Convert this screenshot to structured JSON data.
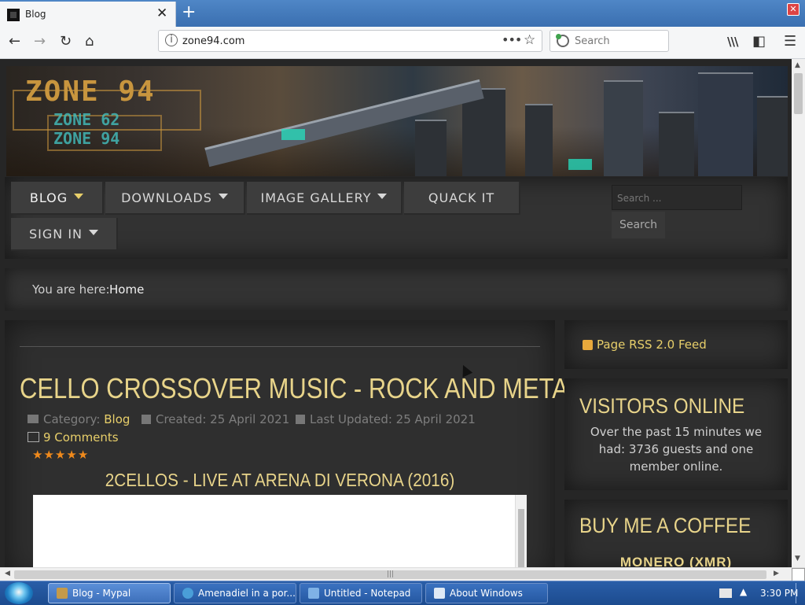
{
  "browser": {
    "tab_title": "Blog",
    "tab_close": "✕",
    "new_tab": "+",
    "url": "zone94.com",
    "search_placeholder": "Search",
    "nav_back": "←",
    "nav_forward": "→",
    "nav_reload": "↻",
    "nav_home": "⌂",
    "url_more": "•••",
    "bookmark_star": "☆",
    "library": "\\\\\\",
    "sidebar": "◧",
    "menu": "☰"
  },
  "site": {
    "logo_main": "ZONE 94",
    "logo_sub_1": "ZONE 62",
    "logo_sub_2": "ZONE 94",
    "menu": [
      {
        "label": "BLOG",
        "has_caret": true
      },
      {
        "label": "DOWNLOADS",
        "has_caret": true
      },
      {
        "label": "IMAGE GALLERY",
        "has_caret": true
      },
      {
        "label": "QUACK IT",
        "has_caret": false
      },
      {
        "label": "SIGN IN",
        "has_caret": true
      }
    ],
    "search_placeholder": "Search ...",
    "search_button": "Search",
    "breadcrumb_label": "You are here:",
    "breadcrumb_home": "Home",
    "article": {
      "title": "CELLO CROSSOVER MUSIC - ROCK AND METAL",
      "category_label": "Category:",
      "category": "Blog",
      "created": "Created: 25 April 2021",
      "updated": "Last Updated: 25 April 2021",
      "comments": "9 Comments",
      "rating_stars": 5,
      "video_title": "2CELLOS - LIVE AT ARENA DI VERONA (2016)"
    },
    "sidebar": {
      "rss": "Page RSS 2.0 Feed",
      "visitors_title": "VISITORS ONLINE",
      "visitors_text": "Over the past 15 minutes we had: 3736 guests and one member online.",
      "coffee_title": "BUY ME A COFFEE",
      "coffee_sub": "MONERO (XMR)"
    }
  },
  "taskbar": {
    "items": [
      {
        "label": "Blog - Mypal",
        "active": true,
        "icon_color": "#c49a4a"
      },
      {
        "label": "Amenadiel in a por...",
        "active": false,
        "icon_color": "#4a9ed8"
      },
      {
        "label": "Untitled - Notepad",
        "active": false,
        "icon_color": "#7fb2e6"
      },
      {
        "label": "About Windows",
        "active": false,
        "icon_color": "#dfe9f5"
      }
    ],
    "clock": "3:30 PM"
  },
  "colors": {
    "accent_gold": "#e8cf6a",
    "title_gold": "#e8d48a",
    "star_orange": "#f08a1c"
  }
}
